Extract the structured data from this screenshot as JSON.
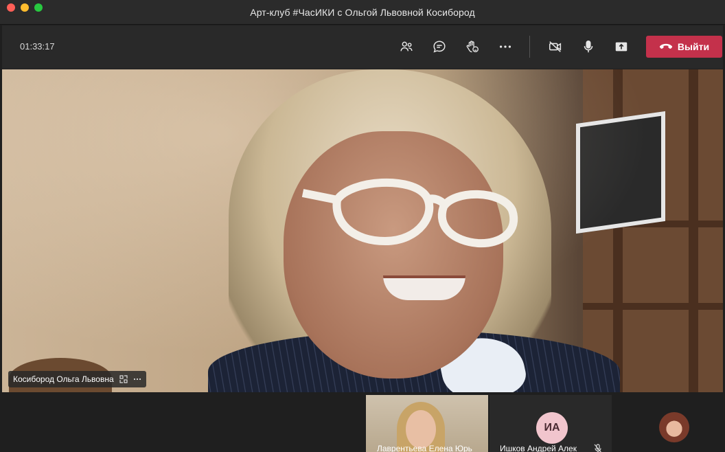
{
  "window": {
    "title": "Арт-клуб #ЧасИКИ с Ольгой Львовной Косибород"
  },
  "toolbar": {
    "timer": "01:33:17",
    "leave_label": "Выйти",
    "icons": [
      "people-icon",
      "chat-icon",
      "raise-hand-icon",
      "more-icon",
      "camera-off-icon",
      "microphone-icon",
      "share-screen-icon",
      "phone-hangup-icon"
    ],
    "leave_color": "#c4314b"
  },
  "main_video": {
    "participant_name": "Косибород Ольга Львовна"
  },
  "participants": [
    {
      "name": "Лаврентьева Елена Юрь",
      "type": "video"
    },
    {
      "name": "Ишков Андрей Алек",
      "initials": "ИА",
      "muted": true,
      "avatar_color": "#f1c5cd"
    },
    {
      "type": "avatar"
    }
  ]
}
